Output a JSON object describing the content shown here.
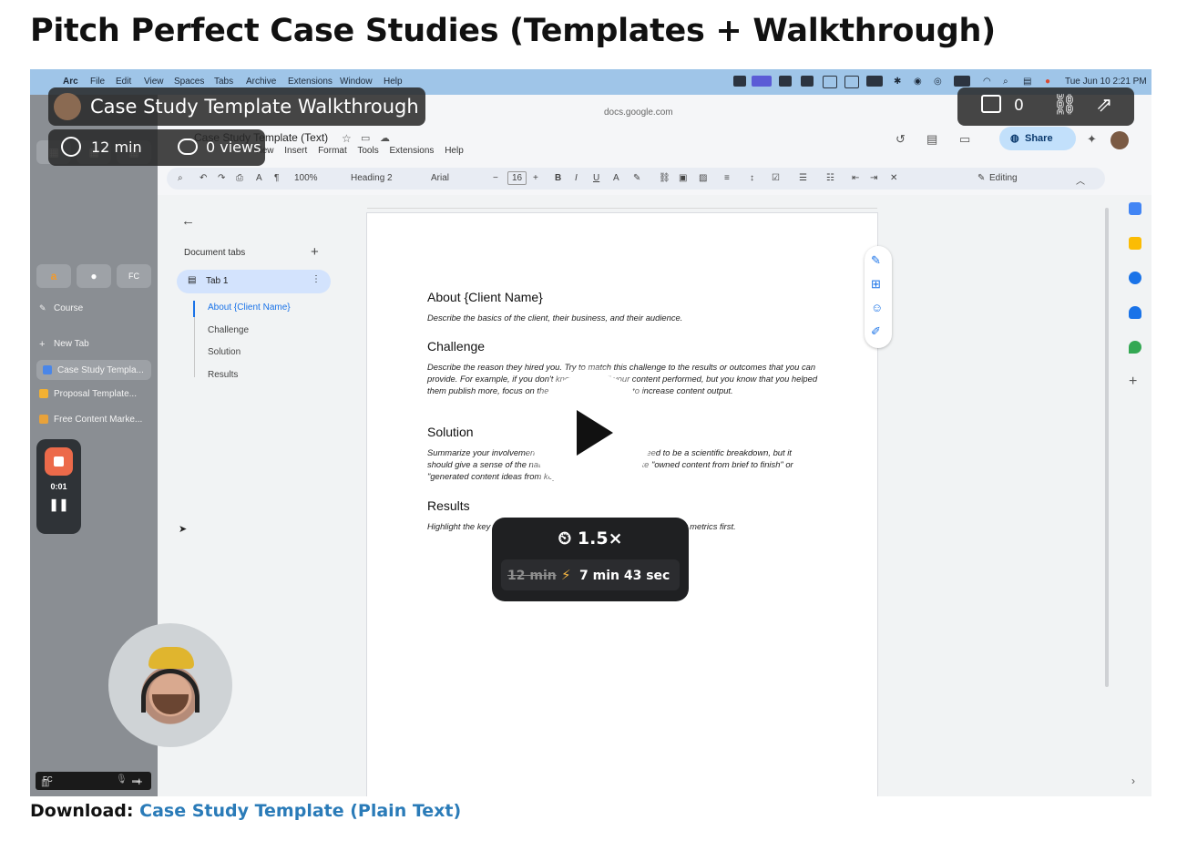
{
  "page": {
    "title": "Pitch Perfect Case Studies (Templates + Walkthrough)",
    "download_label": "Download:",
    "download_link": "Case Study Template (Plain Text)"
  },
  "menubar": {
    "items": [
      "Arc",
      "File",
      "Edit",
      "View",
      "Spaces",
      "Tabs",
      "Archive",
      "Extensions",
      "Window",
      "Help"
    ],
    "clock": "Tue Jun 10  2:21 PM"
  },
  "arc_sidebar": {
    "items": [
      {
        "label": "Course"
      },
      {
        "label": "New Tab"
      },
      {
        "label": "Case Study Templa..."
      },
      {
        "label": "Proposal Template..."
      },
      {
        "label": "Free Content Marke..."
      }
    ]
  },
  "recorder": {
    "time": "0:01"
  },
  "docs": {
    "url": "docs.google.com",
    "doc_title": "Case Study Template (Text)",
    "menus": [
      "View",
      "Insert",
      "Format",
      "Tools",
      "Extensions",
      "Help"
    ],
    "share_label": "Share",
    "editing_label": "Editing",
    "toolbar": {
      "zoom": "100%",
      "style": "Heading 2",
      "font": "Arial",
      "size": "16"
    },
    "outline": {
      "header": "Document tabs",
      "tab": "Tab 1",
      "items": [
        "About {Client Name}",
        "Challenge",
        "Solution",
        "Results"
      ]
    },
    "content": [
      {
        "heading": "About {Client Name}",
        "body": "Describe the basics of the client, their business, and their audience."
      },
      {
        "heading": "Challenge",
        "body": "Describe the reason they hired you. Try to match this challenge to the results or outcomes that you can provide. For example, if you don't know how well your content performed, but you know that you helped them publish more, focus on the challenge of needing to increase content output."
      },
      {
        "heading": "Solution",
        "body": "Summarize your involvement and the work. This doesn't need to be a scientific breakdown, but it should give a sense of the nature of your engagement, like \"owned content from brief to finish\" or \"generated content ideas from keyword research.\""
      },
      {
        "heading": "Results",
        "body": "Highlight the key results and outcomes. Lead with the highest-impact metrics first."
      }
    ]
  },
  "overlay": {
    "video_title": "Case Study Template Walkthrough",
    "duration": "12 min",
    "views": "0 views",
    "comments": "0",
    "speed": "1.5×",
    "speed_old": "12 min",
    "speed_new": "7 min 43 sec"
  },
  "colors": {
    "accent_link": "#2a7bb8",
    "record_red": "#ec6a4a",
    "share_bg": "#c2e0fb"
  }
}
